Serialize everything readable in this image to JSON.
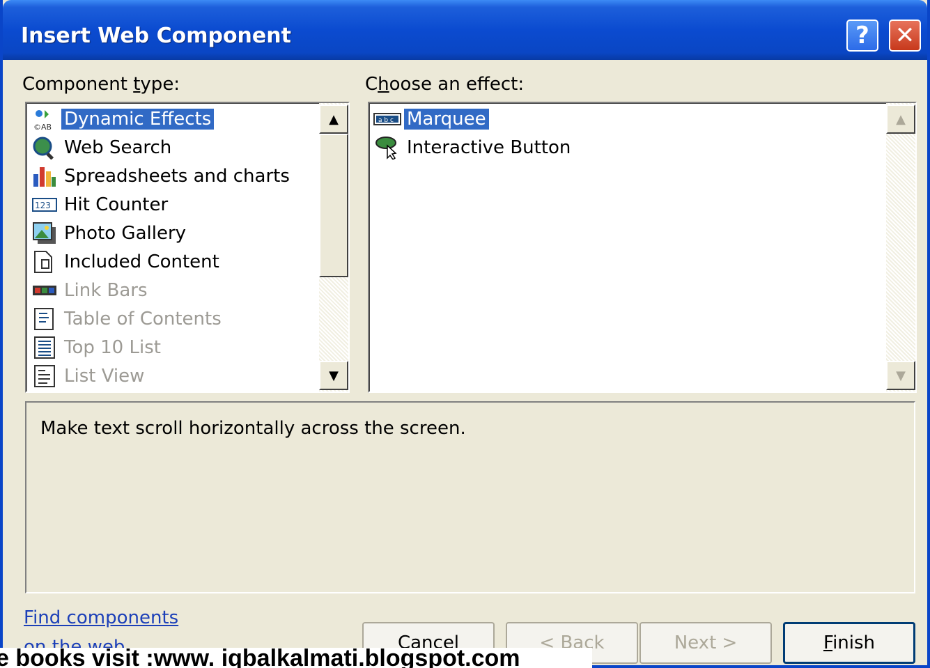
{
  "window": {
    "title": "Insert Web Component",
    "help_label": "?",
    "close_label": "✕"
  },
  "component_type": {
    "label_prefix": "Component ",
    "label_accel": "t",
    "label_suffix": "ype:",
    "items": [
      {
        "label": "Dynamic Effects",
        "icon": "dynamic-effects-icon",
        "state": "selected"
      },
      {
        "label": "Web Search",
        "icon": "web-search-icon",
        "state": "normal"
      },
      {
        "label": "Spreadsheets and charts",
        "icon": "spreadsheets-charts-icon",
        "state": "normal"
      },
      {
        "label": "Hit Counter",
        "icon": "hit-counter-icon",
        "state": "normal"
      },
      {
        "label": "Photo Gallery",
        "icon": "photo-gallery-icon",
        "state": "normal"
      },
      {
        "label": "Included Content",
        "icon": "included-content-icon",
        "state": "normal"
      },
      {
        "label": "Link Bars",
        "icon": "link-bars-icon",
        "state": "disabled"
      },
      {
        "label": "Table of Contents",
        "icon": "table-of-contents-icon",
        "state": "disabled"
      },
      {
        "label": "Top 10 List",
        "icon": "top-10-list-icon",
        "state": "disabled"
      },
      {
        "label": "List View",
        "icon": "list-view-icon",
        "state": "disabled"
      }
    ]
  },
  "effect": {
    "label_prefix": "C",
    "label_accel": "h",
    "label_suffix": "oose an effect:",
    "items": [
      {
        "label": "Marquee",
        "icon": "marquee-icon",
        "state": "selected"
      },
      {
        "label": "Interactive Button",
        "icon": "interactive-button-icon",
        "state": "normal"
      }
    ]
  },
  "description": "Make text scroll horizontally across the screen.",
  "links": {
    "line1": "Find components",
    "line2": "on the web"
  },
  "buttons": {
    "cancel": "Cancel",
    "back": "< Back",
    "next": "Next >",
    "finish_accel": "F",
    "finish_rest": "inish"
  },
  "footer": "e books visit :www. iqbalkalmati.blogspot.com"
}
